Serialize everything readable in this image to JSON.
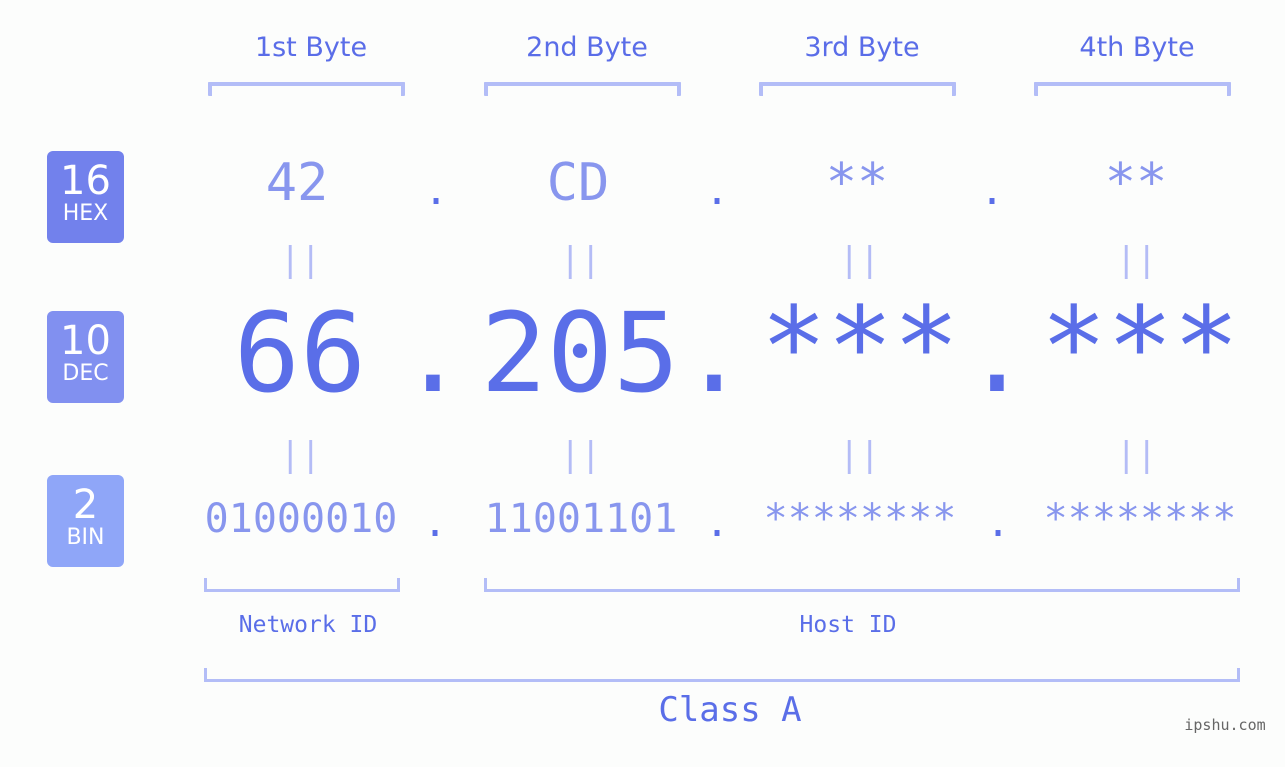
{
  "bytes": {
    "labels": [
      "1st Byte",
      "2nd Byte",
      "3rd Byte",
      "4th Byte"
    ]
  },
  "badges": {
    "hex": {
      "base": "16",
      "name": "HEX",
      "color": "#7281ec"
    },
    "dec": {
      "base": "10",
      "name": "DEC",
      "color": "#8190f0"
    },
    "bin": {
      "base": "2",
      "name": "BIN",
      "color": "#8fa6f8"
    }
  },
  "hex_row": {
    "values": [
      "42",
      "CD",
      "**",
      "**"
    ]
  },
  "dec_row": {
    "values": [
      "66",
      "205",
      "***",
      "***"
    ]
  },
  "bin_row": {
    "values": [
      "01000010",
      "11001101",
      "********",
      "********"
    ]
  },
  "separator": ".",
  "equals_glyph": "||",
  "network_id_label": "Network ID",
  "host_id_label": "Host ID",
  "class_label": "Class A",
  "watermark": "ipshu.com",
  "colors": {
    "primary_text": "#5a6ee8",
    "light_text": "#8896ee",
    "bracket": "#b3bdf7",
    "background": "#fcfdfc"
  }
}
